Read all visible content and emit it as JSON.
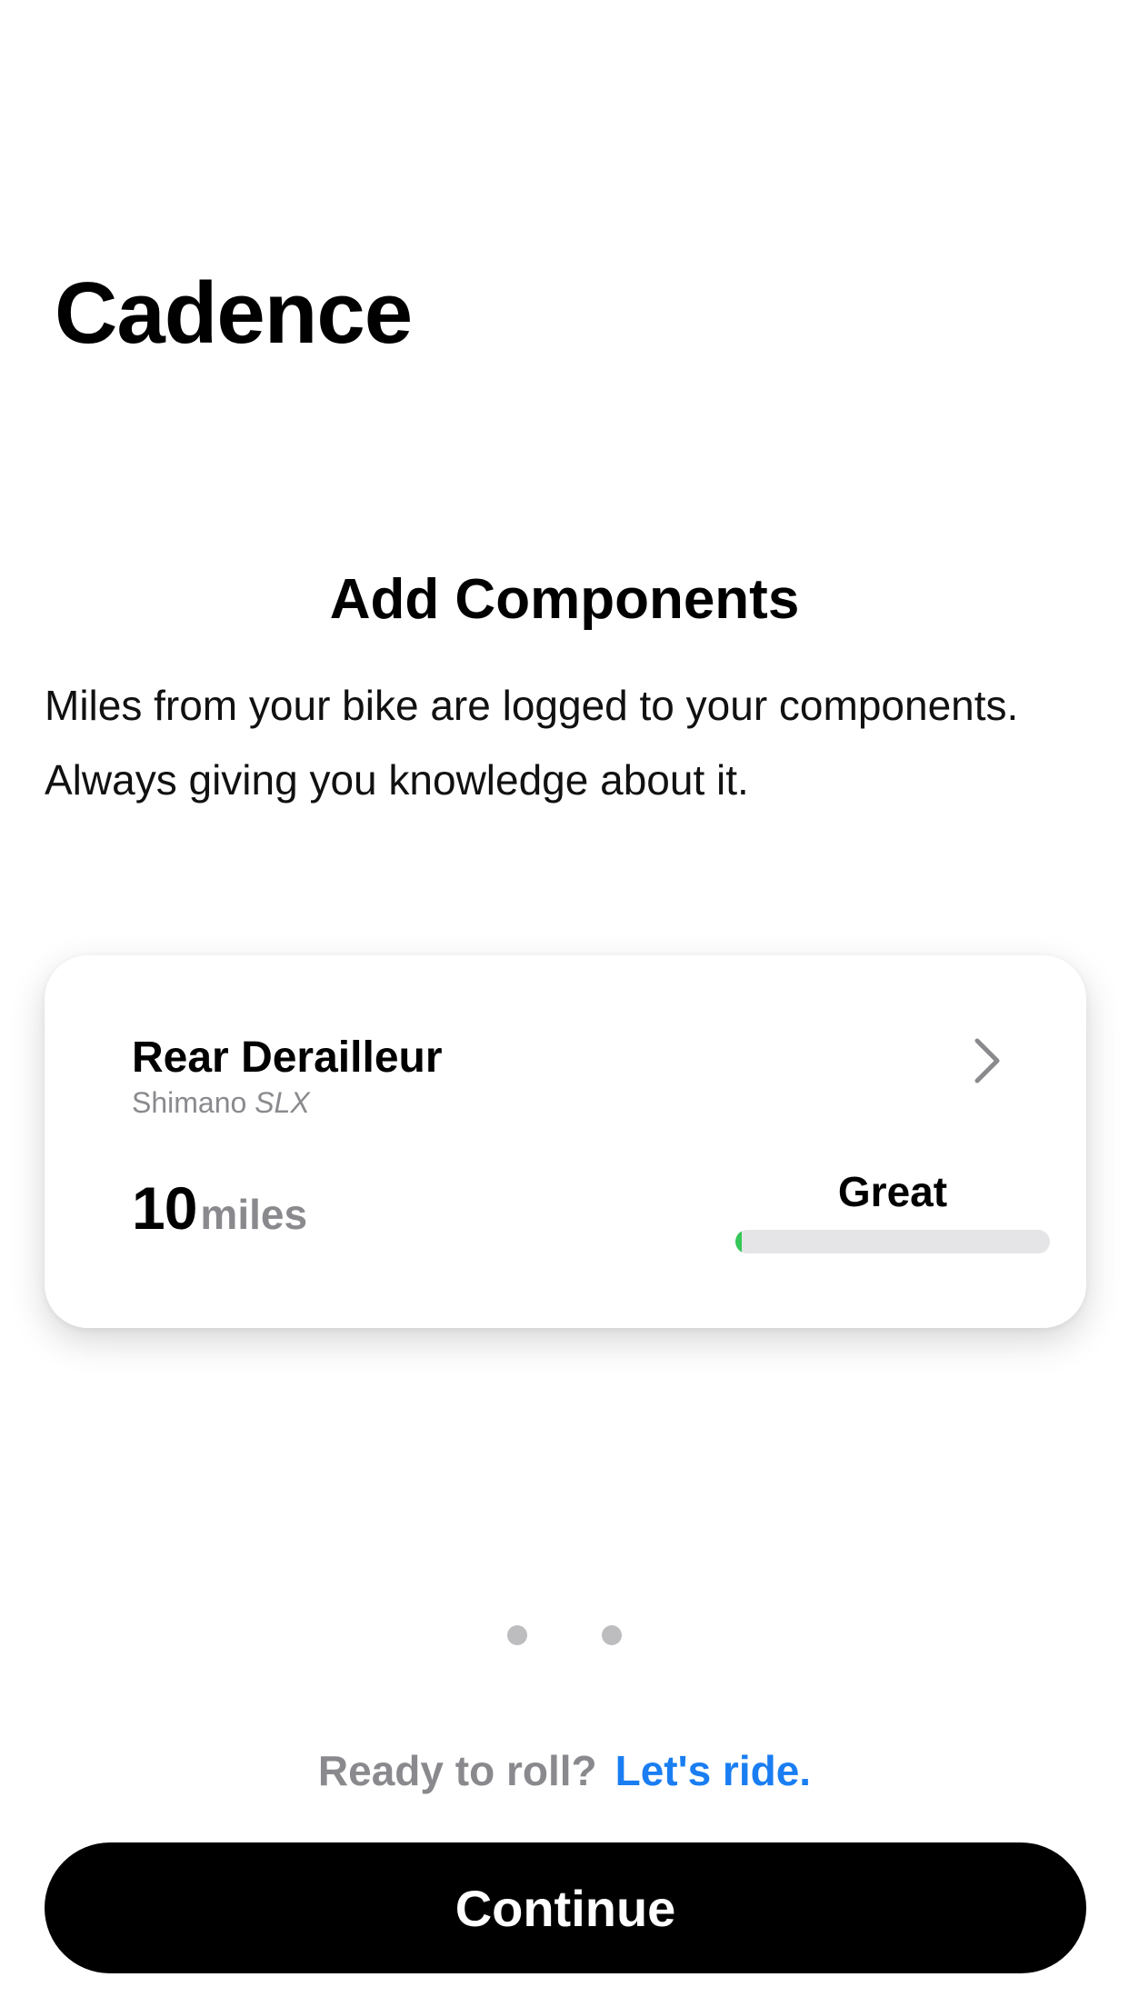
{
  "app": {
    "title": "Cadence"
  },
  "section": {
    "heading": "Add Components",
    "body_lines": [
      "Miles from your bike are logged to your components.",
      "Always giving you knowledge about it."
    ]
  },
  "component_card": {
    "name": "Rear Derailleur",
    "brand": "Shimano",
    "model": "SLX",
    "mileage_value": "10",
    "mileage_unit": "miles",
    "status": "Great",
    "wear_fraction": 0.02,
    "wear_color": "#34c759",
    "chevron_icon": "chevron-right-icon"
  },
  "pager": {
    "page_count": 2,
    "current_index": 0
  },
  "prompt": {
    "text": "Ready to roll?",
    "link": "Let's ride."
  },
  "actions": {
    "continue_label": "Continue"
  },
  "colors": {
    "accent": "#1a7ef2",
    "button_bg": "#000000",
    "muted_text": "#8a8a8e"
  }
}
